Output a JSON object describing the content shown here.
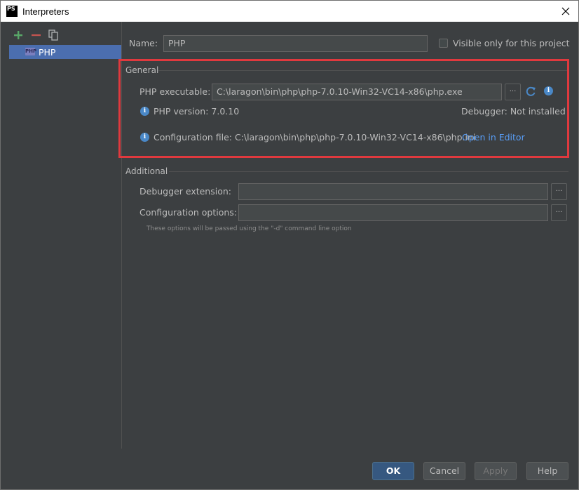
{
  "window": {
    "title": "Interpreters",
    "app_icon_text": "PS"
  },
  "left_panel": {
    "toolbar": {
      "add_icon": "plus-icon",
      "remove_icon": "minus-icon",
      "copy_icon": "copy-icon"
    },
    "items": [
      {
        "label": "PHP",
        "icon": "php-icon",
        "icon_text": "PHP",
        "selected": true
      }
    ]
  },
  "header": {
    "name_label": "Name:",
    "name_value": "PHP",
    "visible_only_label": "Visible only for this project",
    "visible_only_checked": false
  },
  "general": {
    "title": "General",
    "php_executable_label": "PHP executable:",
    "php_executable_value": "C:\\laragon\\bin\\php\\php-7.0.10-Win32-VC14-x86\\php.exe",
    "browse_label": "...",
    "php_version_text": "PHP version: 7.0.10",
    "debugger_text": "Debugger: Not installed",
    "config_file_text": "Configuration file: C:\\laragon\\bin\\php\\php-7.0.10-Win32-VC14-x86\\php.ini",
    "open_in_editor_label": "Open in Editor",
    "info_glyph": "i"
  },
  "additional": {
    "title": "Additional",
    "debugger_extension_label": "Debugger extension:",
    "debugger_extension_value": "",
    "configuration_options_label": "Configuration options:",
    "configuration_options_value": "",
    "browse_label": "...",
    "hint": "These options will be passed using the \"-d\" command line option"
  },
  "buttons": {
    "ok": "OK",
    "cancel": "Cancel",
    "apply": "Apply",
    "help": "Help"
  },
  "colors": {
    "background": "#3c3f41",
    "selection": "#4b6eaf",
    "highlight_border": "#e0393e",
    "link": "#589df6",
    "primary_button": "#365880",
    "add_icon": "#59a869",
    "remove_icon": "#c75450",
    "info_icon": "#4a88c7"
  }
}
